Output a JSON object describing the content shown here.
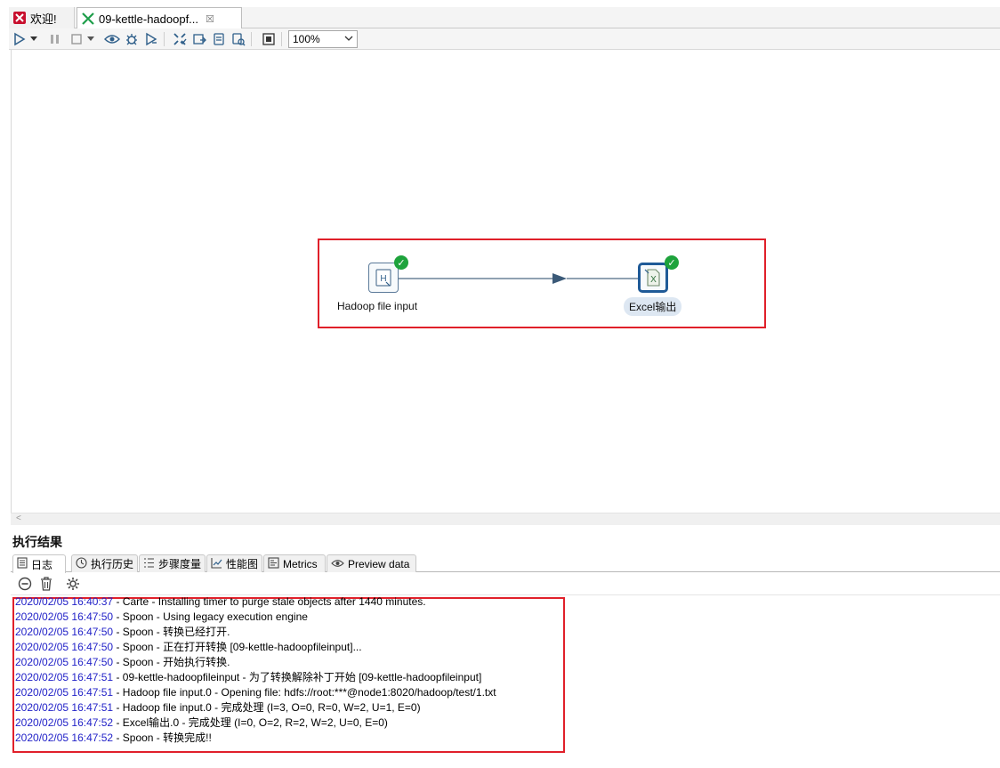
{
  "tabs": [
    {
      "label": "欢迎!",
      "icon": "spoon-logo-icon"
    },
    {
      "label": "09-kettle-hadoopf...",
      "icon": "transformation-icon",
      "close": "☒"
    }
  ],
  "toolbar": {
    "zoom_value": "100%"
  },
  "canvas": {
    "steps": [
      {
        "name": "Hadoop file input",
        "icon_letter": "H",
        "status": "ok"
      },
      {
        "name": "Excel输出",
        "icon_letter": "X",
        "status": "ok",
        "selected": true
      }
    ]
  },
  "results": {
    "title": "执行结果",
    "tabs": [
      {
        "label": "日志",
        "icon": "log-icon"
      },
      {
        "label": "执行历史",
        "icon": "history-icon"
      },
      {
        "label": "步骤度量",
        "icon": "step-metrics-icon"
      },
      {
        "label": "性能图",
        "icon": "performance-graph-icon"
      },
      {
        "label": "Metrics",
        "icon": "metrics-icon"
      },
      {
        "label": "Preview data",
        "icon": "preview-eye-icon"
      }
    ],
    "log_lines": [
      {
        "ts": "2020/02/05 16:40:37",
        "msg": " - Carte - Installing timer to purge stale objects after 1440 minutes."
      },
      {
        "ts": "2020/02/05 16:47:50",
        "msg": " - Spoon - Using legacy execution engine"
      },
      {
        "ts": "2020/02/05 16:47:50",
        "msg": " - Spoon - 转换已经打开."
      },
      {
        "ts": "2020/02/05 16:47:50",
        "msg": " - Spoon - 正在打开转换 [09-kettle-hadoopfileinput]..."
      },
      {
        "ts": "2020/02/05 16:47:50",
        "msg": " - Spoon - 开始执行转换."
      },
      {
        "ts": "2020/02/05 16:47:51",
        "msg": " - 09-kettle-hadoopfileinput - 为了转换解除补丁开始  [09-kettle-hadoopfileinput]"
      },
      {
        "ts": "2020/02/05 16:47:51",
        "msg": " - Hadoop file input.0 - Opening file: hdfs://root:***@node1:8020/hadoop/test/1.txt"
      },
      {
        "ts": "2020/02/05 16:47:51",
        "msg": " - Hadoop file input.0 - 完成处理 (I=3, O=0, R=0, W=2, U=1, E=0)"
      },
      {
        "ts": "2020/02/05 16:47:52",
        "msg": " - Excel输出.0 - 完成处理 (I=0, O=2, R=2, W=2, U=0, E=0)"
      },
      {
        "ts": "2020/02/05 16:47:52",
        "msg": " - Spoon - 转换完成!!"
      }
    ]
  },
  "colors": {
    "highlight_box": "#e0202a",
    "timestamp": "#2222c8",
    "ok_badge": "#1ea33c"
  }
}
